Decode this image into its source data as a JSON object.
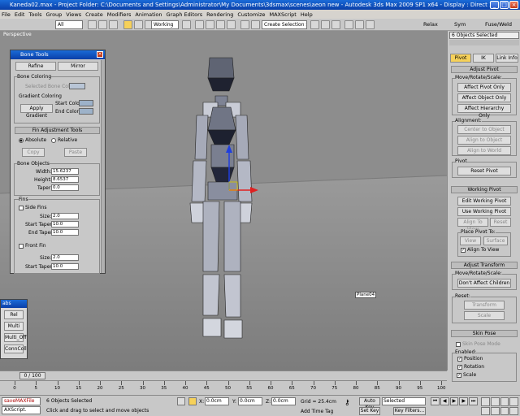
{
  "window": {
    "title": "Kaneda02.max    - Project Folder: C:\\Documents and Settings\\Administrator\\My Documents\\3dsmax\\scenes\\aeon new      - Autodesk 3ds Max  2009 SP1  x64      - Display : Direct 3D"
  },
  "menu": [
    "File",
    "Edit",
    "Tools",
    "Group",
    "Views",
    "Create",
    "Modifiers",
    "Animation",
    "Graph Editors",
    "Rendering",
    "Customize",
    "MAXScript",
    "Help"
  ],
  "toolbar": {
    "filter": "All",
    "coord": "Working",
    "selection_set": "Create Selection Set",
    "relax": "Relax",
    "sym": "Sym",
    "fuse_weld": "Fuse/Weld"
  },
  "viewport": {
    "label": "Perspective",
    "object_tag": "Plane04"
  },
  "bone_tools": {
    "title": "Bone Tools",
    "refine": "Refine",
    "mirror": "Mirror",
    "bone_coloring": "Bone Coloring",
    "selected_bone_color": "Selected Bone Color:",
    "gradient_coloring": "Gradient Coloring",
    "apply_gradient": "Apply Gradient",
    "start_color": "Start Color:",
    "end_color": "End Color:",
    "fin_tools": "Fin Adjustment Tools",
    "absolute": "Absolute",
    "relative": "Relative",
    "copy": "Copy",
    "paste": "Paste",
    "bone_objects": "Bone Objects",
    "width_label": "Width:",
    "width_value": "15.6237",
    "height_label": "Height:",
    "height_value": "8.6537",
    "taper_label": "Taper:",
    "taper_value": "0.0",
    "fins": "Fins",
    "side_fins": "Side Fins",
    "size_label": "Size:",
    "size_value": "2.0",
    "start_taper_label": "Start Taper:",
    "start_taper_value": "10.0",
    "end_taper_label": "End Taper:",
    "end_taper_value": "10.0",
    "front_fin": "Front Fin",
    "front_size_value": "2.0",
    "front_start_taper_value": "10.0"
  },
  "small_panel": {
    "title": "abs",
    "items": [
      "Rel",
      "Multi",
      "Multi_Off",
      "ConnColl"
    ]
  },
  "right_panel": {
    "selection": "6 Objects Selected",
    "tabs": [
      "Pivot",
      "IK",
      "Link Info"
    ],
    "adjust_pivot": "Adjust Pivot",
    "move_rotate_scale": "Move/Rotate/Scale:",
    "affect_pivot_only": "Affect Pivot Only",
    "affect_object_only": "Affect Object Only",
    "affect_hierarchy_only": "Affect Hierarchy Only",
    "alignment": "Alignment:",
    "center_to_object": "Center to Object",
    "align_to_object": "Align to Object",
    "align_to_world": "Align to World",
    "pivot": "Pivot",
    "reset_pivot": "Reset Pivot",
    "working_pivot": "Working Pivot",
    "edit_working_pivot": "Edit Working Pivot",
    "use_working_pivot": "Use Working Pivot",
    "align_to_view": "Align To View",
    "reset": "Reset",
    "place_pivot_to": "Place Pivot To:",
    "view": "View",
    "surface": "Surface",
    "align_to_view_chk": "Align To View",
    "adjust_transform": "Adjust Transform",
    "mrs2": "Move/Rotate/Scale:",
    "dont_affect_children": "Don't Affect Children",
    "reset2": "Reset:",
    "transform": "Transform",
    "scale": "Scale",
    "skin_pose": "Skin Pose",
    "skin_pose_mode": "Skin Pose Mode",
    "enabled": "Enabled:",
    "position": "Position",
    "rotation": "Rotation",
    "scale_chk": "Scale"
  },
  "timeline": {
    "frame": "0 / 100"
  },
  "ruler_ticks": [
    "0",
    "5",
    "10",
    "15",
    "20",
    "25",
    "30",
    "35",
    "40",
    "45",
    "50",
    "55",
    "60",
    "65",
    "70",
    "75",
    "80",
    "85",
    "90",
    "95",
    "100"
  ],
  "status": {
    "listener1": "saveMAXFile",
    "listener2": "AXScript.",
    "objects_selected": "6 Objects Selected",
    "prompt": "Click and drag to select and move objects",
    "x_label": "X:",
    "x_value": "0.0cm",
    "y_label": "Y:",
    "y_value": "0.0cm",
    "z_label": "Z:",
    "z_value": "0.0cm",
    "grid": "Grid = 25.4cm",
    "add_time_tag": "Add Time Tag",
    "auto_key": "Auto Key",
    "set_key": "Set Key",
    "selected": "Selected",
    "key_filters": "Key Filters..."
  }
}
